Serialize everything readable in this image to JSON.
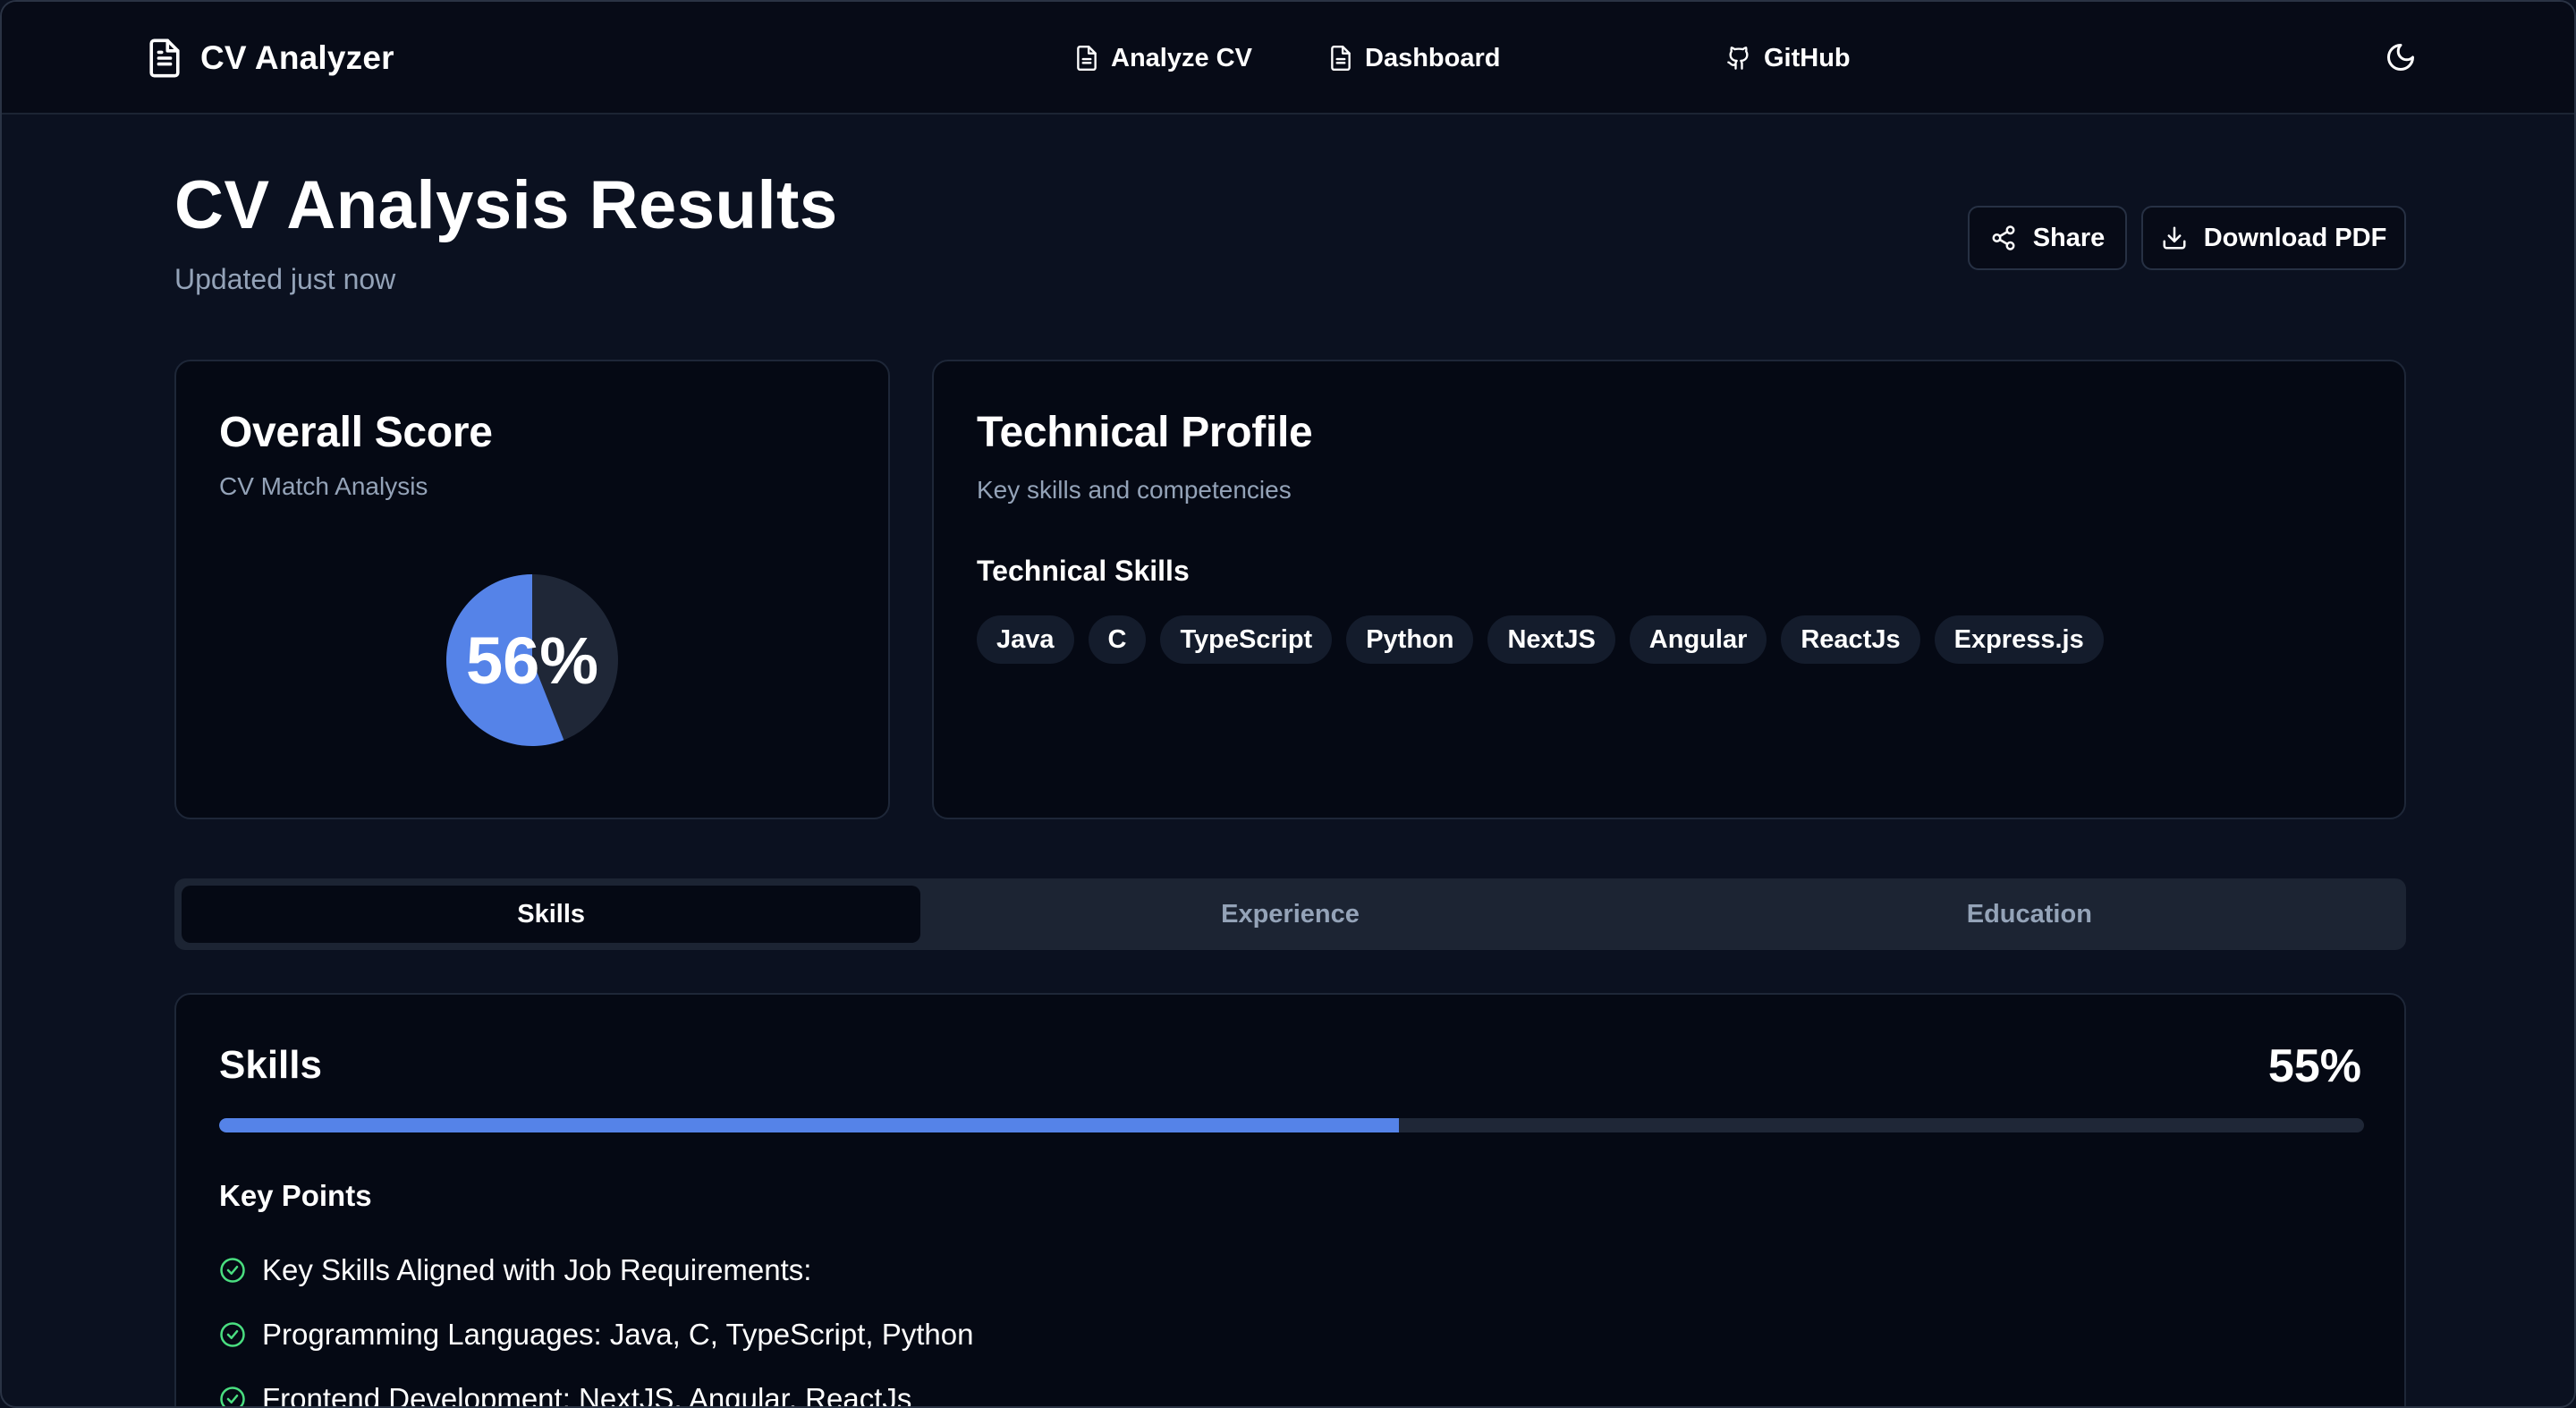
{
  "header": {
    "brand": "CV Analyzer",
    "nav": {
      "analyze": "Analyze CV",
      "dashboard": "Dashboard",
      "github": "GitHub"
    }
  },
  "page": {
    "title": "CV Analysis Results",
    "subtitle": "Updated just now",
    "share_label": "Share",
    "download_label": "Download PDF"
  },
  "score_card": {
    "title": "Overall Score",
    "subtitle": "CV Match Analysis",
    "score_text": "56%",
    "score_value": 56,
    "colors": {
      "fill": "#5583e8",
      "rest": "#1f2737"
    }
  },
  "profile_card": {
    "title": "Technical Profile",
    "subtitle": "Key skills and competencies",
    "skills_heading": "Technical Skills",
    "skills": [
      "Java",
      "C",
      "TypeScript",
      "Python",
      "NextJS",
      "Angular",
      "ReactJs",
      "Express.js"
    ]
  },
  "tabs": [
    "Skills",
    "Experience",
    "Education"
  ],
  "active_tab": "Skills",
  "skills_section": {
    "title": "Skills",
    "percent_text": "55%",
    "percent_value": 55,
    "key_points_heading": "Key Points",
    "key_points": [
      "Key Skills Aligned with Job Requirements:",
      "Programming Languages: Java, C, TypeScript, Python",
      "Frontend Development: NextJS, Angular, ReactJs"
    ]
  },
  "icons": {
    "brand": "file-text-icon",
    "analyze": "file-icon",
    "dashboard": "file-icon",
    "github": "github-icon",
    "theme": "moon-icon",
    "share": "share-icon",
    "download": "download-icon",
    "check": "check-circle-icon"
  }
}
